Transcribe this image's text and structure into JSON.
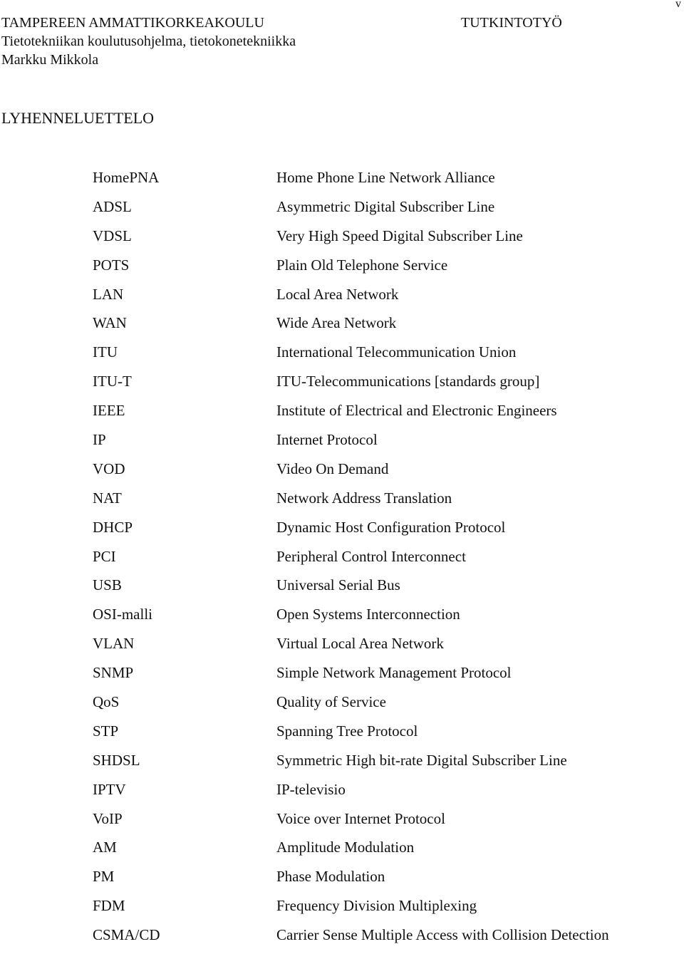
{
  "header": {
    "institution": "TAMPEREEN AMMATTIKORKEAKOULU",
    "program": "Tietotekniikan koulutusohjelma, tietokonetekniikka",
    "author": "Markku Mikkola",
    "document_type": "TUTKINTOTYÖ",
    "page_number": "v"
  },
  "section": {
    "title": "LYHENNELUETTELO"
  },
  "abbreviations": [
    {
      "term": "HomePNA",
      "definition": "Home Phone Line Network Alliance"
    },
    {
      "term": "ADSL",
      "definition": "Asymmetric Digital Subscriber Line"
    },
    {
      "term": "VDSL",
      "definition": "Very High Speed Digital Subscriber Line"
    },
    {
      "term": "POTS",
      "definition": "Plain Old Telephone Service"
    },
    {
      "term": "LAN",
      "definition": "Local Area Network"
    },
    {
      "term": "WAN",
      "definition": "Wide Area Network"
    },
    {
      "term": "ITU",
      "definition": "International Telecommunication Union"
    },
    {
      "term": "ITU-T",
      "definition": "ITU-Telecommunications [standards group]"
    },
    {
      "term": "IEEE",
      "definition": "Institute of Electrical and Electronic Engineers"
    },
    {
      "term": "IP",
      "definition": "Internet Protocol"
    },
    {
      "term": "VOD",
      "definition": "Video On Demand"
    },
    {
      "term": "NAT",
      "definition": "Network Address Translation"
    },
    {
      "term": "DHCP",
      "definition": "Dynamic Host Configuration Protocol"
    },
    {
      "term": "PCI",
      "definition": "Peripheral Control Interconnect"
    },
    {
      "term": "USB",
      "definition": "Universal Serial Bus"
    },
    {
      "term": "OSI-malli",
      "definition": "Open Systems Interconnection"
    },
    {
      "term": "VLAN",
      "definition": "Virtual Local Area Network"
    },
    {
      "term": "SNMP",
      "definition": "Simple Network Management Protocol"
    },
    {
      "term": "QoS",
      "definition": "Quality of Service"
    },
    {
      "term": "STP",
      "definition": "Spanning Tree Protocol"
    },
    {
      "term": "SHDSL",
      "definition": "Symmetric High bit-rate Digital Subscriber Line"
    },
    {
      "term": "IPTV",
      "definition": "IP-televisio"
    },
    {
      "term": "VoIP",
      "definition": "Voice over Internet Protocol"
    },
    {
      "term": "AM",
      "definition": "Amplitude Modulation"
    },
    {
      "term": "PM",
      "definition": "Phase Modulation"
    },
    {
      "term": "FDM",
      "definition": "Frequency Division Multiplexing"
    },
    {
      "term": "CSMA/CD",
      "definition": "Carrier Sense Multiple Access with Collision Detection"
    }
  ]
}
